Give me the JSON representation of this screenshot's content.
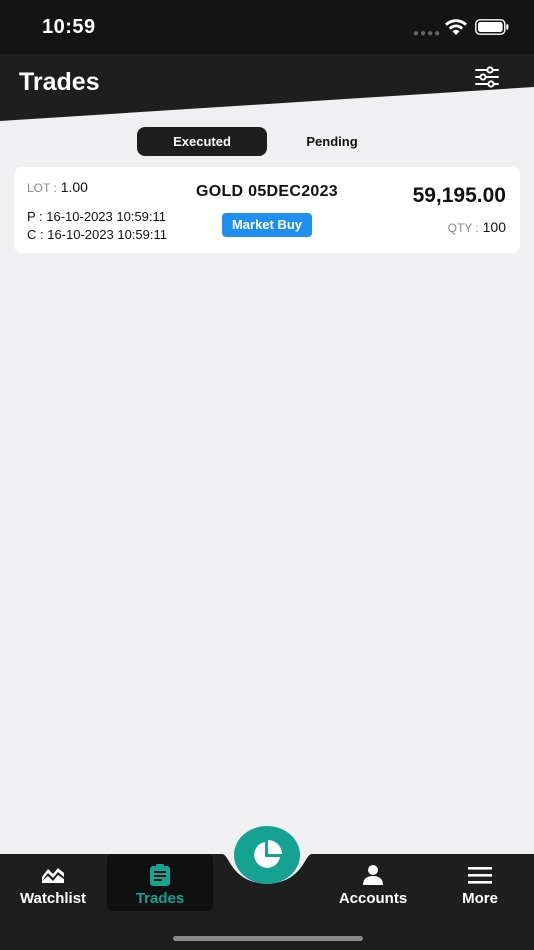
{
  "status_bar": {
    "time": "10:59"
  },
  "header": {
    "title": "Trades"
  },
  "tabs": [
    {
      "label": "Executed",
      "active": true
    },
    {
      "label": "Pending",
      "active": false
    }
  ],
  "trades": [
    {
      "lot_label": "LOT :",
      "lot": "1.00",
      "p_time": "P : 16-10-2023 10:59:11",
      "c_time": "C : 16-10-2023 10:59:11",
      "symbol": "GOLD 05DEC2023",
      "side": "Market Buy",
      "price": "59,195.00",
      "qty_label": "QTY :",
      "qty": "100"
    }
  ],
  "bottom_nav": {
    "items": [
      {
        "label": "Watchlist",
        "icon": "chart-icon"
      },
      {
        "label": "Trades",
        "icon": "clipboard-icon",
        "active": true
      },
      {
        "label": "Accounts",
        "icon": "user-icon"
      },
      {
        "label": "More",
        "icon": "menu-icon"
      }
    ],
    "fab_icon": "pie-chart-icon"
  },
  "colors": {
    "header_bg": "#1e1e1e",
    "accent": "#15a293",
    "badge_blue": "#1f8ff0",
    "page_bg": "#f0f0f2"
  }
}
